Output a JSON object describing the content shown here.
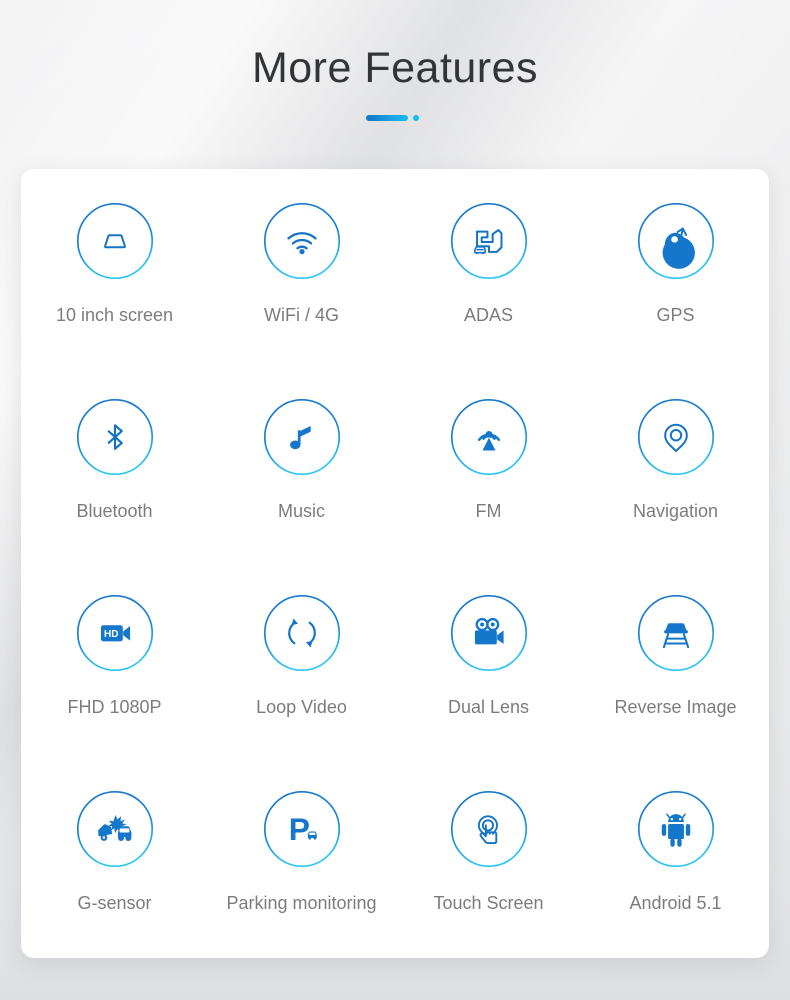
{
  "header": {
    "title": "More Features",
    "accent_color_start": "#1273c6",
    "accent_color_end": "#17bbef"
  },
  "theme": {
    "icon_blue": "#1573c6",
    "icon_cyan": "#19bdf0",
    "label_color": "#7b7c7e",
    "card_background": "#ffffff",
    "page_background": "#eeeeef"
  },
  "features": [
    {
      "label": "10 inch screen",
      "icon": "screen-icon"
    },
    {
      "label": "WiFi / 4G",
      "icon": "wifi-icon"
    },
    {
      "label": "ADAS",
      "icon": "adas-road-car-icon"
    },
    {
      "label": "GPS",
      "icon": "satellite-dish-icon"
    },
    {
      "label": "Bluetooth",
      "icon": "bluetooth-icon"
    },
    {
      "label": "Music",
      "icon": "music-note-icon"
    },
    {
      "label": "FM",
      "icon": "fm-broadcast-tower-icon"
    },
    {
      "label": "Navigation",
      "icon": "map-pin-icon"
    },
    {
      "label": "FHD 1080P",
      "icon": "hd-camcorder-icon"
    },
    {
      "label": "Loop Video",
      "icon": "loop-arrows-icon"
    },
    {
      "label": "Dual Lens",
      "icon": "dual-lens-camera-icon"
    },
    {
      "label": "Reverse Image",
      "icon": "reverse-car-guidelines-icon"
    },
    {
      "label": "G-sensor",
      "icon": "car-collision-icon"
    },
    {
      "label": "Parking monitoring",
      "icon": "parking-p-car-icon"
    },
    {
      "label": "Touch Screen",
      "icon": "touch-hand-icon"
    },
    {
      "label": "Android 5.1",
      "icon": "android-robot-icon"
    }
  ]
}
